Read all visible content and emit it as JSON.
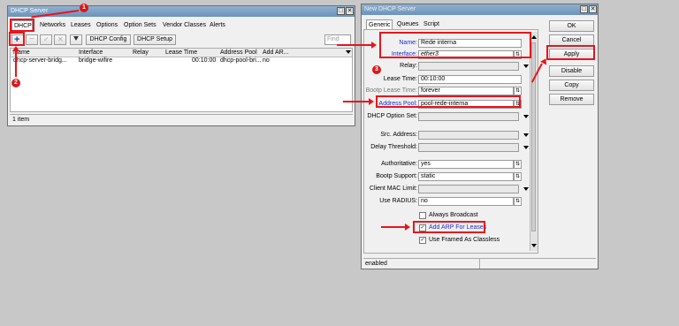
{
  "dhcp_server": {
    "title": "DHCP Server",
    "tabs": [
      "DHCP",
      "Networks",
      "Leases",
      "Options",
      "Option Sets",
      "Vendor Classes",
      "Alerts"
    ],
    "toolbar": {
      "dhcp_config": "DHCP Config",
      "dhcp_setup": "DHCP Setup",
      "find_placeholder": "Find"
    },
    "columns": [
      "Name",
      "Interface",
      "Relay",
      "Lease Time",
      "Address Pool",
      "Add AR..."
    ],
    "rows": [
      [
        "dhcp-server-bridg...",
        "bridge-wifire",
        "",
        "00:10:00",
        "dhcp-pool-bri...",
        "no"
      ]
    ],
    "status": "1 item"
  },
  "new_dhcp": {
    "title": "New DHCP Server",
    "tabs": [
      "Generic",
      "Queues",
      "Script"
    ],
    "fields": {
      "name": {
        "label": "Name:",
        "value": "Rede interna"
      },
      "interface": {
        "label": "Interface:",
        "value": "ether3"
      },
      "relay": {
        "label": "Relay:",
        "value": ""
      },
      "lease_time": {
        "label": "Lease Time:",
        "value": "00:10:00"
      },
      "bootp_lease_time": {
        "label": "Bootp Lease Time:",
        "value": "forever"
      },
      "address_pool": {
        "label": "Address Pool:",
        "value": "pool-rede-interna"
      },
      "dhcp_option_set": {
        "label": "DHCP Option Set:",
        "value": ""
      },
      "src_address": {
        "label": "Src. Address:",
        "value": ""
      },
      "delay_threshold": {
        "label": "Delay Threshold:",
        "value": ""
      },
      "authoritative": {
        "label": "Authoritative:",
        "value": "yes"
      },
      "bootp_support": {
        "label": "Bootp Support:",
        "value": "static"
      },
      "client_mac_limit": {
        "label": "Client MAC Limit:",
        "value": ""
      },
      "use_radius": {
        "label": "Use RADIUS:",
        "value": "no"
      }
    },
    "checkboxes": {
      "always_broadcast": {
        "label": "Always Broadcast",
        "checked": false
      },
      "add_arp": {
        "label": "Add ARP For Leases",
        "checked": true
      },
      "use_framed": {
        "label": "Use Framed As Classless",
        "checked": true
      }
    },
    "buttons": {
      "ok": "OK",
      "cancel": "Cancel",
      "apply": "Apply",
      "disable": "Disable",
      "copy": "Copy",
      "remove": "Remove"
    },
    "status": "enabled"
  },
  "annotations": {
    "step1": "1",
    "step2": "2",
    "step3": "3"
  },
  "colors": {
    "highlight": "#e8141c",
    "title_bar": "#7fa2c6"
  }
}
